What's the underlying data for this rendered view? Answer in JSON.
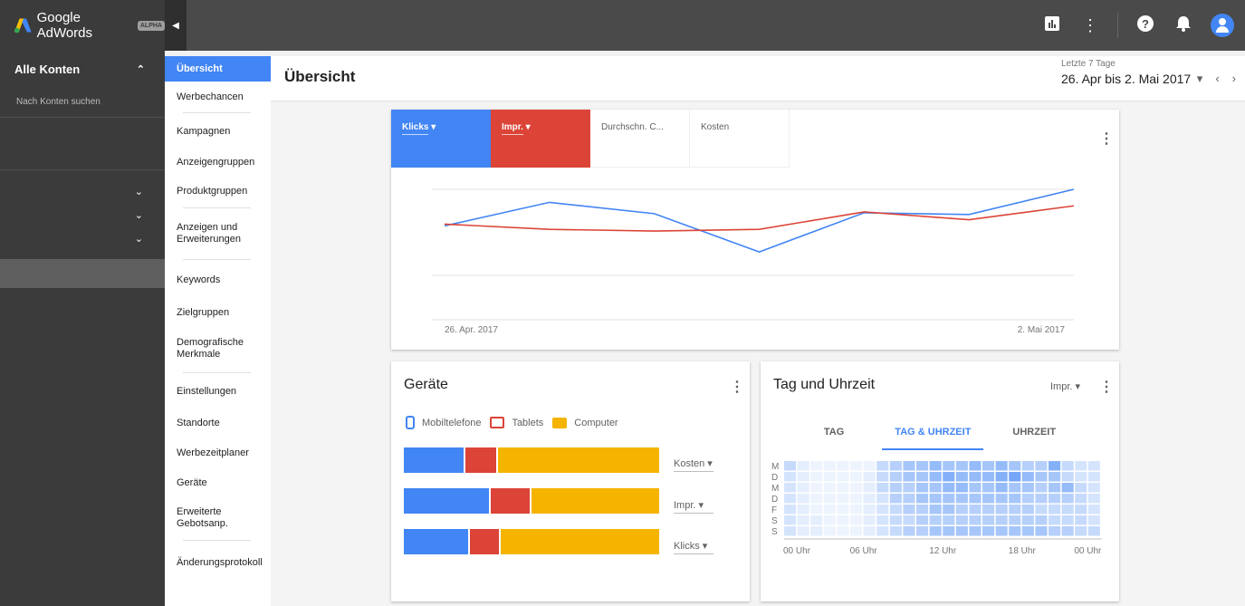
{
  "app": {
    "name": "Google AdWords",
    "badge": "ALPHA"
  },
  "topbar": {
    "icons": [
      "reports-icon",
      "more-vert-icon",
      "help-icon",
      "bell-icon",
      "account-avatar"
    ]
  },
  "accounts": {
    "title": "Alle Konten",
    "search_placeholder": "Nach Konten suchen"
  },
  "nav": {
    "items": [
      {
        "label": "Übersicht",
        "active": true,
        "h": 28
      },
      {
        "label": "Werbechancen",
        "h": 34
      },
      {
        "sep": true
      },
      {
        "label": "Kampagnen",
        "h": 40
      },
      {
        "label": "Anzeigengruppen",
        "h": 28
      },
      {
        "label": "Produktgruppen",
        "h": 36
      },
      {
        "sep": true
      },
      {
        "label": "Anzeigen und Erweiterungen",
        "h": 56
      },
      {
        "sep": true
      },
      {
        "label": "Keywords",
        "h": 44
      },
      {
        "label": "Zielgruppen",
        "h": 28
      },
      {
        "label": "Demografische Merkmale",
        "h": 52
      },
      {
        "sep": true
      },
      {
        "label": "Einstellungen",
        "h": 40
      },
      {
        "label": "Standorte",
        "h": 30
      },
      {
        "label": "Werbezeitplaner",
        "h": 36
      },
      {
        "label": "Geräte",
        "h": 30
      },
      {
        "label": "Erweiterte Gebotsanp.",
        "h": 48
      },
      {
        "sep": true
      },
      {
        "label": "Änderungsprotokoll",
        "h": 48
      }
    ]
  },
  "header": {
    "title": "Übersicht",
    "date_label": "Letzte 7 Tage",
    "date_range": "26. Apr bis 2. Mai 2017"
  },
  "overview_chart": {
    "tabs": [
      "Klicks",
      "Impr.",
      "Durchschn. C...",
      "Kosten"
    ],
    "colors": {
      "klicks": "#4285f4",
      "impr": "#db4437"
    },
    "chart_data": {
      "type": "line",
      "x": [
        "26. Apr. 2017",
        "27. Apr. 2017",
        "28. Apr. 2017",
        "29. Apr. 2017",
        "30. Apr. 2017",
        "1. Mai 2017",
        "2. Mai 2017"
      ],
      "x_tick_labels": [
        "26. Apr. 2017",
        "2. Mai 2017"
      ],
      "series": [
        {
          "name": "Klicks",
          "color": "#4285f4",
          "values": [
            0.58,
            0.85,
            0.72,
            0.28,
            0.73,
            0.71,
            1.0
          ]
        },
        {
          "name": "Impr.",
          "color": "#db4437",
          "values": [
            0.6,
            0.54,
            0.52,
            0.54,
            0.74,
            0.65,
            0.81
          ]
        }
      ],
      "ylim": [
        -0.5,
        1.0
      ],
      "grid": true
    }
  },
  "devices": {
    "title": "Geräte",
    "legend": [
      {
        "name": "Mobiltelefone",
        "color": "#4285f4",
        "icon": "phone-icon"
      },
      {
        "name": "Tablets",
        "color": "#db4437",
        "icon": "tablet-icon"
      },
      {
        "name": "Computer",
        "color": "#f4b400",
        "icon": "computer-icon"
      }
    ],
    "chart_data": {
      "type": "bar",
      "categories": [
        "Kosten",
        "Impr.",
        "Klicks"
      ],
      "series": [
        {
          "name": "Mobiltelefone",
          "values": [
            24,
            34,
            26
          ]
        },
        {
          "name": "Tablets",
          "values": [
            13,
            16,
            12
          ]
        },
        {
          "name": "Computer",
          "values": [
            63,
            50,
            62
          ]
        }
      ]
    },
    "rows": [
      {
        "label": "Kosten"
      },
      {
        "label": "Impr."
      },
      {
        "label": "Klicks"
      }
    ]
  },
  "daytime": {
    "title": "Tag und Uhrzeit",
    "metric": "Impr.",
    "tabs": [
      "TAG",
      "TAG & UHRZEIT",
      "UHRZEIT"
    ],
    "active_tab": 1,
    "chart_data": {
      "type": "heatmap",
      "y": [
        "M",
        "D",
        "M",
        "D",
        "F",
        "S",
        "S"
      ],
      "x_tick_labels": [
        "00 Uhr",
        "06 Uhr",
        "12 Uhr",
        "18 Uhr",
        "00 Uhr"
      ],
      "hours": 24,
      "values": [
        [
          0.3,
          0.1,
          0.05,
          0.05,
          0.05,
          0.05,
          0.05,
          0.3,
          0.4,
          0.5,
          0.5,
          0.6,
          0.5,
          0.5,
          0.6,
          0.5,
          0.6,
          0.5,
          0.4,
          0.4,
          0.7,
          0.3,
          0.2,
          0.2
        ],
        [
          0.2,
          0.1,
          0.05,
          0.05,
          0.05,
          0.05,
          0.1,
          0.3,
          0.4,
          0.5,
          0.5,
          0.6,
          0.7,
          0.6,
          0.6,
          0.6,
          0.7,
          0.8,
          0.6,
          0.5,
          0.5,
          0.3,
          0.2,
          0.2
        ],
        [
          0.2,
          0.1,
          0.05,
          0.05,
          0.05,
          0.05,
          0.1,
          0.3,
          0.4,
          0.4,
          0.5,
          0.5,
          0.6,
          0.6,
          0.5,
          0.5,
          0.6,
          0.5,
          0.5,
          0.4,
          0.5,
          0.6,
          0.3,
          0.2
        ],
        [
          0.2,
          0.1,
          0.05,
          0.05,
          0.05,
          0.05,
          0.1,
          0.2,
          0.4,
          0.4,
          0.5,
          0.5,
          0.5,
          0.5,
          0.5,
          0.5,
          0.5,
          0.5,
          0.4,
          0.4,
          0.4,
          0.4,
          0.3,
          0.2
        ],
        [
          0.2,
          0.1,
          0.05,
          0.05,
          0.05,
          0.05,
          0.1,
          0.2,
          0.3,
          0.4,
          0.4,
          0.5,
          0.5,
          0.4,
          0.4,
          0.4,
          0.4,
          0.4,
          0.4,
          0.3,
          0.3,
          0.3,
          0.3,
          0.2
        ],
        [
          0.2,
          0.1,
          0.1,
          0.05,
          0.05,
          0.05,
          0.1,
          0.2,
          0.3,
          0.3,
          0.4,
          0.4,
          0.4,
          0.4,
          0.4,
          0.4,
          0.4,
          0.4,
          0.4,
          0.4,
          0.3,
          0.3,
          0.3,
          0.2
        ],
        [
          0.2,
          0.1,
          0.1,
          0.05,
          0.05,
          0.05,
          0.1,
          0.2,
          0.3,
          0.4,
          0.4,
          0.5,
          0.5,
          0.5,
          0.5,
          0.5,
          0.5,
          0.5,
          0.5,
          0.5,
          0.4,
          0.4,
          0.3,
          0.3
        ]
      ]
    }
  }
}
